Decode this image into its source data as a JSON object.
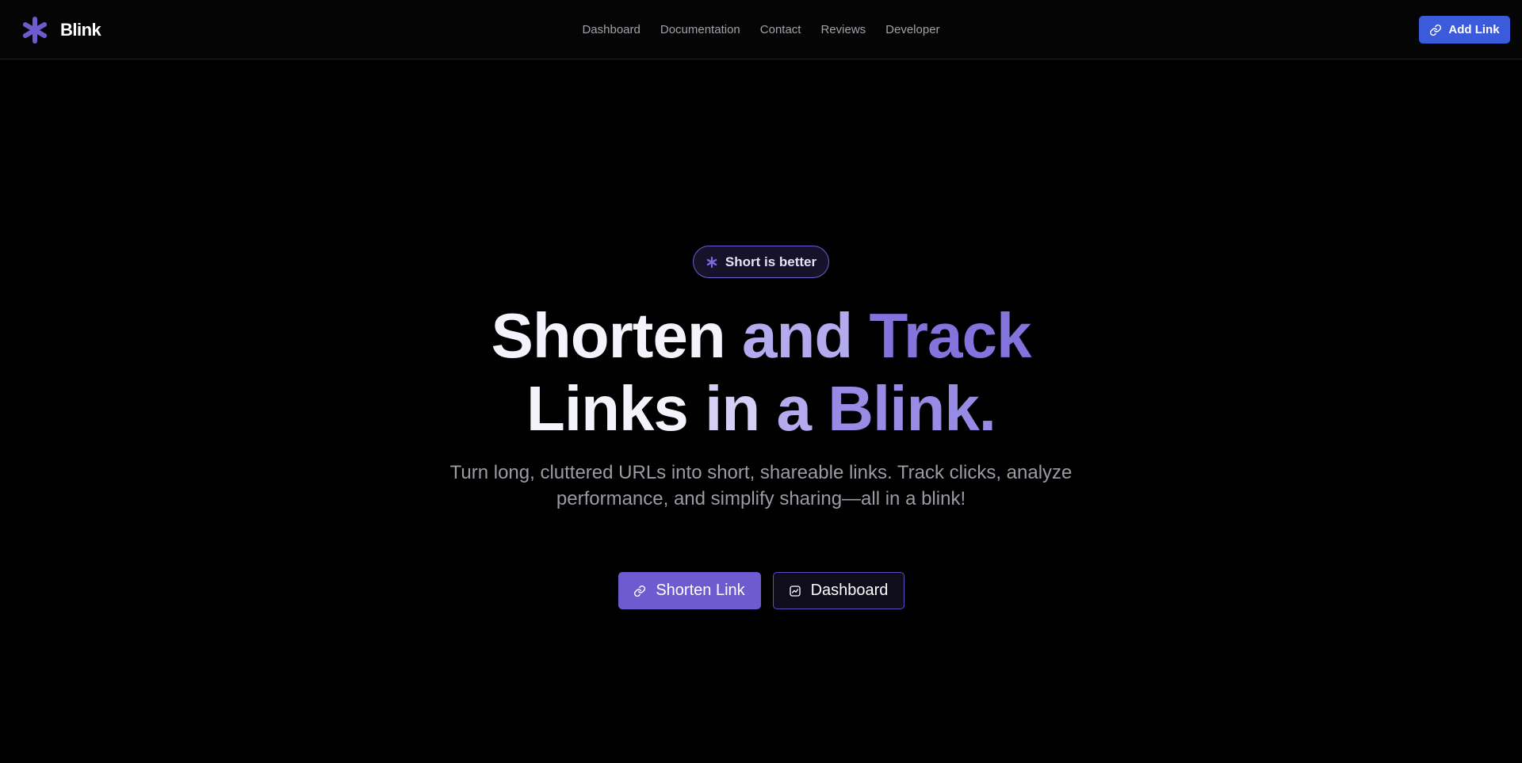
{
  "brand": {
    "name": "Blink",
    "icon": "asterisk-logo-icon",
    "color": "#6e5bd0"
  },
  "nav": {
    "items": [
      {
        "label": "Dashboard"
      },
      {
        "label": "Documentation"
      },
      {
        "label": "Contact"
      },
      {
        "label": "Reviews"
      },
      {
        "label": "Developer"
      }
    ]
  },
  "header_action": {
    "label": "Add Link",
    "icon": "link-icon",
    "color": "#3b5bdb"
  },
  "hero": {
    "badge": {
      "label": "Short is better",
      "icon": "asterisk-icon"
    },
    "headline": {
      "line1": {
        "w1": "Shorten",
        "w2": "and",
        "w3": "Track"
      },
      "line2": {
        "w1": "Links",
        "w2": "in",
        "w3": "a",
        "w4": "Blink."
      }
    },
    "subtitle": {
      "line1": "Turn long, cluttered URLs into short, shareable links. Track clicks, analyze",
      "line2": "performance, and simplify sharing—all in a blink!"
    },
    "primary_cta": {
      "label": "Shorten Link",
      "icon": "link-icon"
    },
    "secondary_cta": {
      "label": "Dashboard",
      "icon": "chart-icon"
    }
  },
  "colors": {
    "background": "#000000",
    "accent_blue": "#3b5bdb",
    "accent_violet": "#6e5bd0"
  }
}
